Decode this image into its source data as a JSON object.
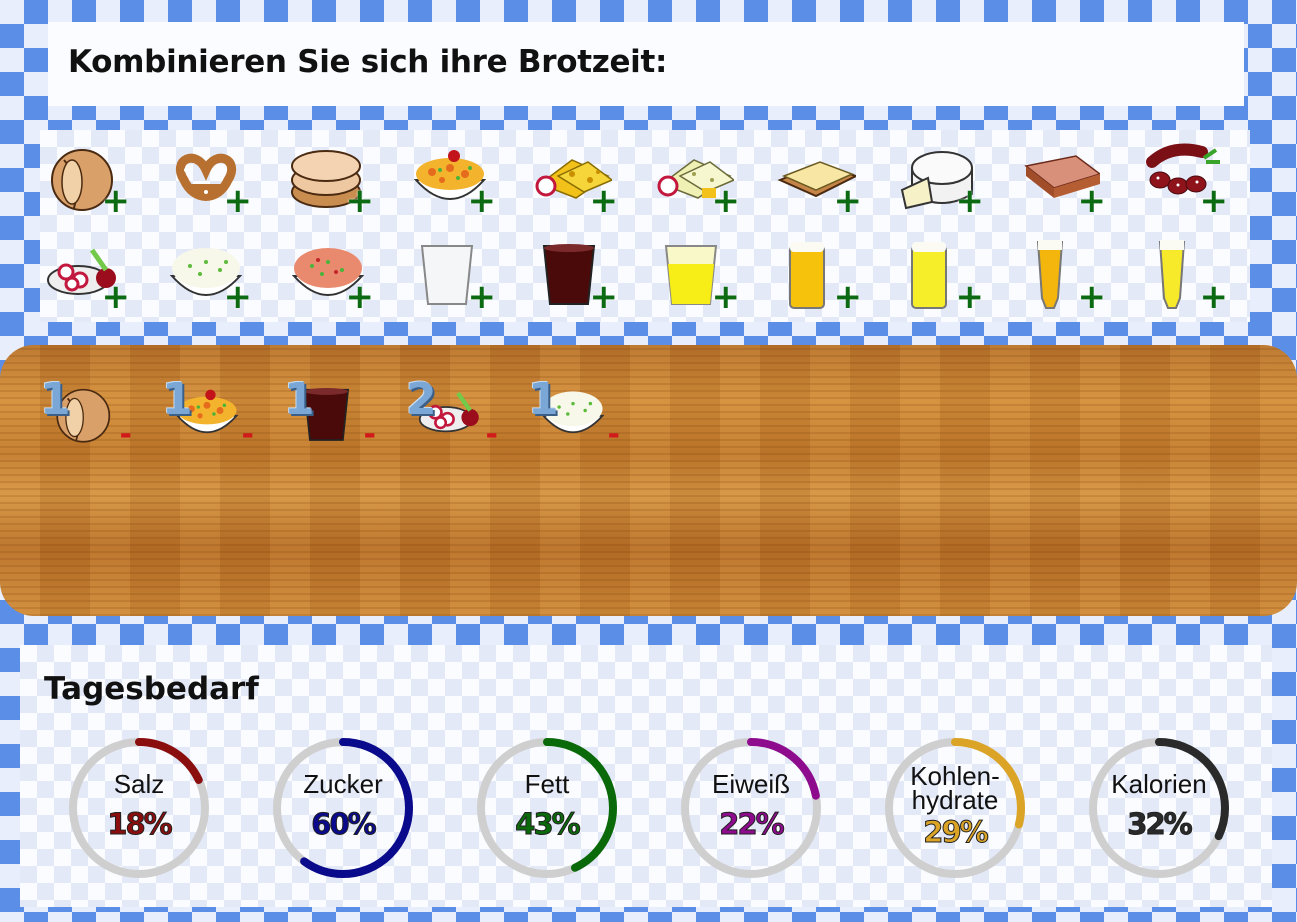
{
  "header": {
    "title": "Kombinieren Sie sich ihre Brotzeit:"
  },
  "menu": {
    "add_symbol": "+",
    "items": [
      {
        "name": "semmel",
        "icon": "bread-roll-icon"
      },
      {
        "name": "brezn",
        "icon": "pretzel-icon"
      },
      {
        "name": "brot",
        "icon": "bread-slices-icon"
      },
      {
        "name": "wurstsalat",
        "icon": "sausage-salad-bowl-icon"
      },
      {
        "name": "kaese",
        "icon": "cheese-slices-icon"
      },
      {
        "name": "kaese-hell",
        "icon": "light-cheese-slices-icon"
      },
      {
        "name": "butterbrot",
        "icon": "butter-bread-icon"
      },
      {
        "name": "camembert",
        "icon": "camembert-icon"
      },
      {
        "name": "leberkaese",
        "icon": "meatloaf-icon"
      },
      {
        "name": "salami",
        "icon": "salami-icon"
      },
      {
        "name": "radi",
        "icon": "radish-plate-icon"
      },
      {
        "name": "obatzda-weiss",
        "icon": "cream-cheese-bowl-icon"
      },
      {
        "name": "obatzda",
        "icon": "obatzda-bowl-icon"
      },
      {
        "name": "wasser",
        "icon": "water-glass-icon"
      },
      {
        "name": "cola",
        "icon": "cola-glass-icon"
      },
      {
        "name": "limo",
        "icon": "lemonade-glass-icon"
      },
      {
        "name": "bier-hell",
        "icon": "beer-mug-icon"
      },
      {
        "name": "bier-radler",
        "icon": "beer-mug-light-icon"
      },
      {
        "name": "weissbier",
        "icon": "wheat-beer-glass-icon"
      },
      {
        "name": "weissbier-hell",
        "icon": "wheat-beer-glass-light-icon"
      }
    ]
  },
  "table": {
    "remove_symbol": "-",
    "items": [
      {
        "name": "semmel",
        "qty": "1",
        "icon": "bread-roll-icon"
      },
      {
        "name": "wurstsalat",
        "qty": "1",
        "icon": "sausage-salad-bowl-icon"
      },
      {
        "name": "cola",
        "qty": "1",
        "icon": "cola-glass-icon"
      },
      {
        "name": "radi",
        "qty": "2",
        "icon": "radish-plate-icon"
      },
      {
        "name": "obatzda-weiss",
        "qty": "1",
        "icon": "cream-cheese-bowl-icon"
      }
    ]
  },
  "needs": {
    "title": "Tagesbedarf",
    "gauges": [
      {
        "label": "Salz",
        "pct": "18%",
        "value": 0.18,
        "color": "#8b0e0e"
      },
      {
        "label": "Zucker",
        "pct": "60%",
        "value": 0.6,
        "color": "#0a0a8c"
      },
      {
        "label": "Fett",
        "pct": "43%",
        "value": 0.43,
        "color": "#0a6a0a"
      },
      {
        "label": "Eiweiß",
        "pct": "22%",
        "value": 0.22,
        "color": "#8e0b8e"
      },
      {
        "label": "Kohlen-hydrate",
        "label_line1": "Kohlen-",
        "label_line2": "hydrate",
        "pct": "29%",
        "value": 0.29,
        "color": "#dba427"
      },
      {
        "label": "Kalorien",
        "pct": "32%",
        "value": 0.32,
        "color": "#2a2a2a"
      }
    ]
  }
}
